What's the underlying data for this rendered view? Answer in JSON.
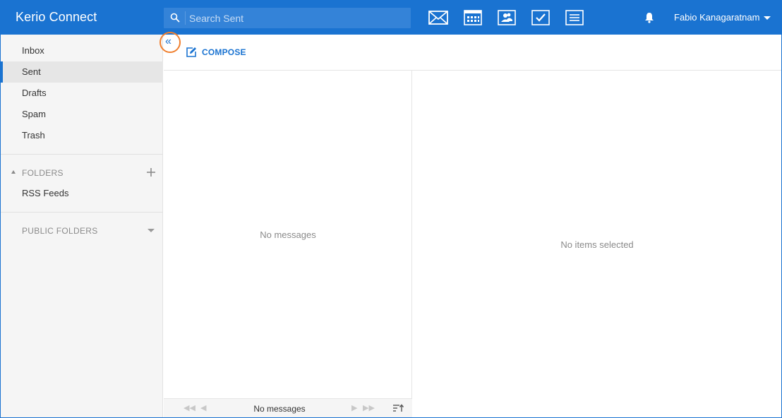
{
  "app": {
    "title": "Kerio Connect"
  },
  "search": {
    "placeholder": "Search Sent"
  },
  "modules": [
    {
      "icon": "mail-icon"
    },
    {
      "icon": "calendar-icon"
    },
    {
      "icon": "contacts-icon"
    },
    {
      "icon": "tasks-icon"
    },
    {
      "icon": "notes-icon"
    }
  ],
  "user": {
    "name": "Fabio Kanagaratnam"
  },
  "sidebar": {
    "mail_items": [
      {
        "label": "Inbox"
      },
      {
        "label": "Sent"
      },
      {
        "label": "Drafts"
      },
      {
        "label": "Spam"
      },
      {
        "label": "Trash"
      }
    ],
    "active": "Sent",
    "folders_title": "FOLDERS",
    "folders": [
      {
        "label": "RSS Feeds"
      }
    ],
    "public_folders_title": "PUBLIC FOLDERS"
  },
  "toolbar": {
    "collapse_glyph": "«",
    "compose_label": "COMPOSE"
  },
  "message_list": {
    "empty_text": "No messages"
  },
  "pager": {
    "text": "No messages"
  },
  "preview": {
    "empty_text": "No items selected"
  },
  "colors": {
    "accent": "#1a73d1",
    "highlight": "#f08030"
  }
}
